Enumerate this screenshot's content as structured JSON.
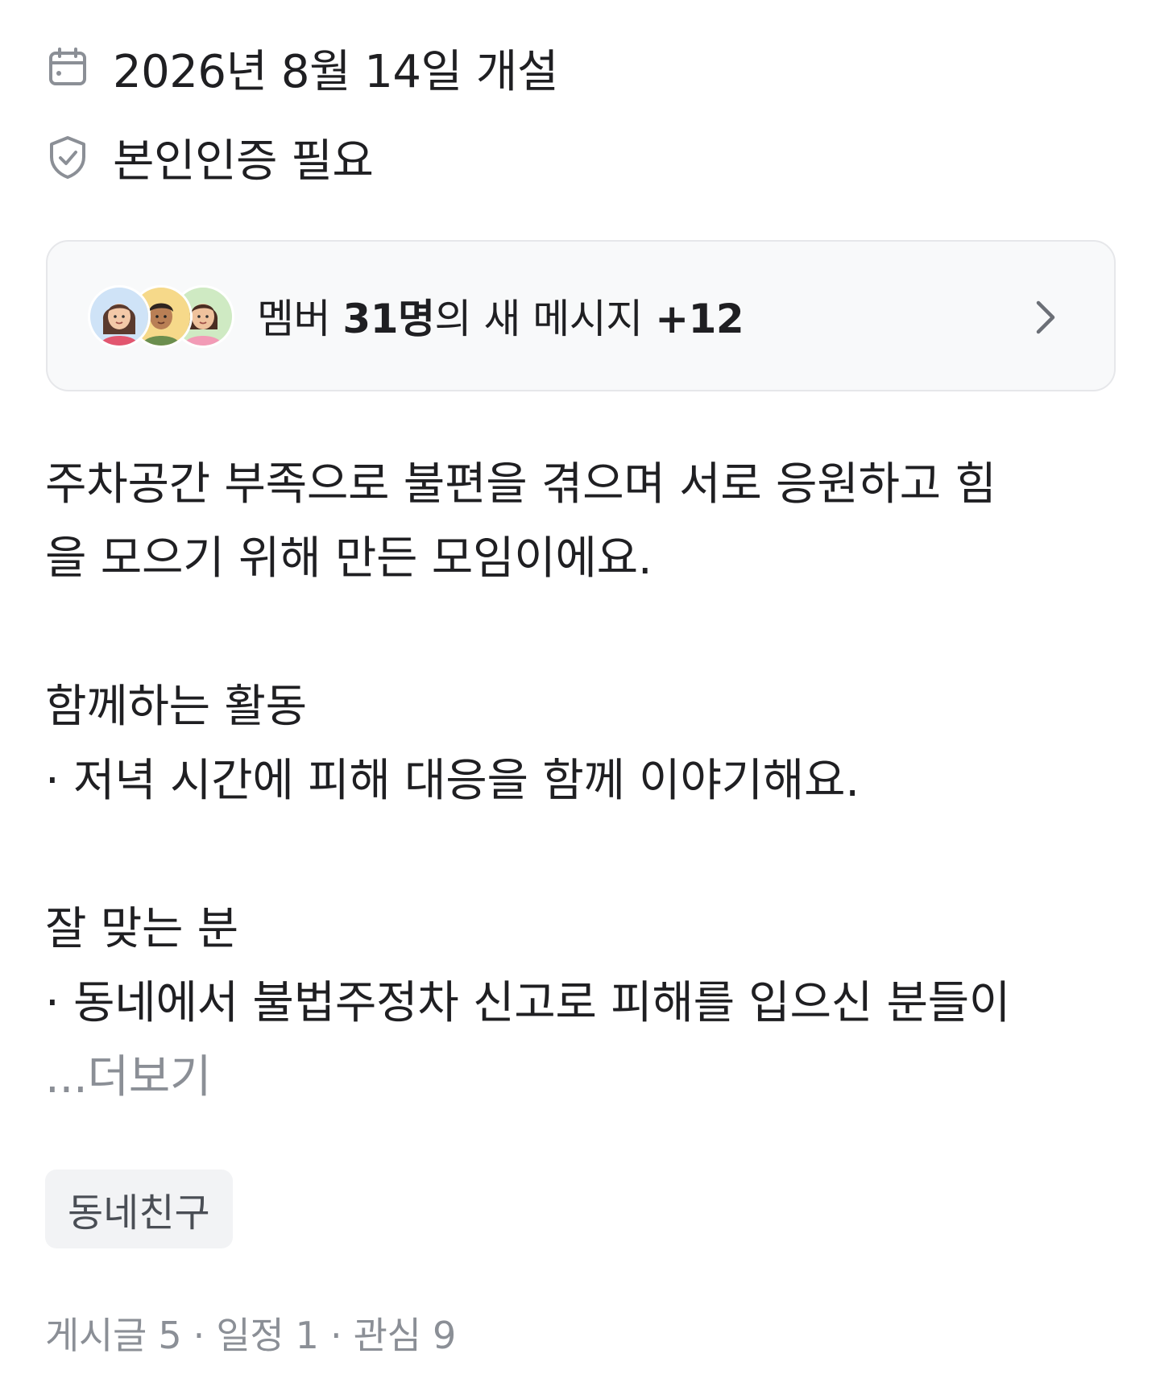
{
  "meta": {
    "opened_text": "2026년 8월 14일 개설",
    "opened_icon": "calendar-icon",
    "verify_text": "본인인증 필요",
    "verify_icon": "shield-check-icon"
  },
  "member_card": {
    "prefix": "멤버 ",
    "count": "31명",
    "middle": "의 새 메시지 ",
    "new_count": "+12",
    "avatars": [
      "avatar-woman-icon",
      "avatar-man-icon",
      "avatar-woman-icon"
    ],
    "chevron_icon": "chevron-right-icon"
  },
  "description": {
    "line1": "주차공간 부족으로 불편을 겪으며 서로 응원하고 힘",
    "line2": "을 모으기 위해 만든 모임이에요.",
    "activity_heading": "함께하는 활동",
    "activity_item": "· 저녁 시간에 피해 대응을 함께 이야기해요.",
    "fit_heading": "잘 맞는 분",
    "fit_item": "· 동네에서 불법주정차 신고로 피해를 입으신 분들이",
    "more_label": "...더보기"
  },
  "tag": {
    "label": "동네친구"
  },
  "stats": {
    "text": "게시글 5 · 일정 1 · 관심 9"
  },
  "colors": {
    "text_primary": "#1f1f22",
    "text_secondary": "#8b8f96",
    "card_bg": "#f8f9fa",
    "card_border": "#e6e7ea",
    "tag_bg": "#f2f3f5"
  }
}
